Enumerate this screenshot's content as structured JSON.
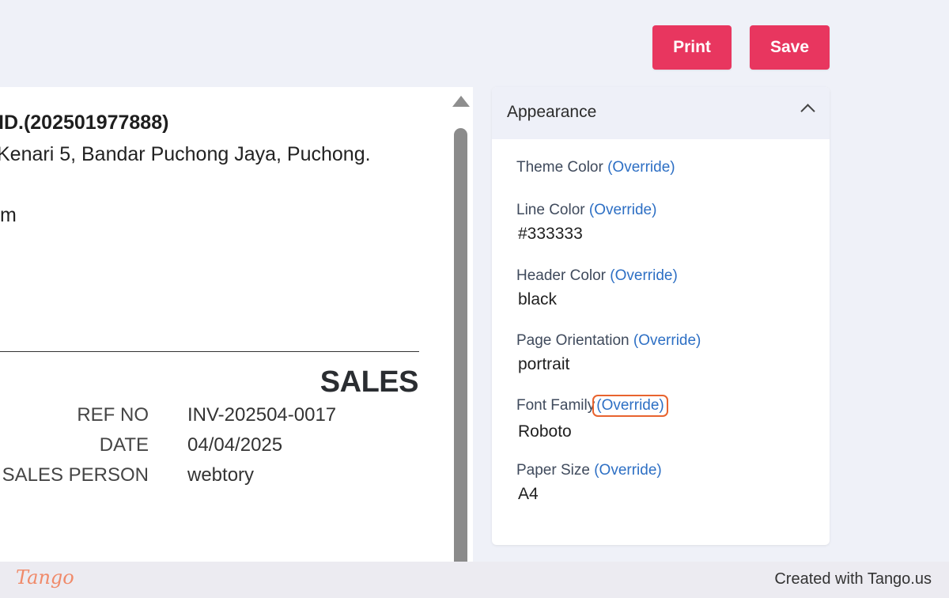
{
  "toolbar": {
    "print_label": "Print",
    "save_label": "Save",
    "button_color": "#e8365f"
  },
  "document": {
    "company_line": "ID.(202501977888)",
    "address_line": "Kenari 5, Bandar Puchong Jaya, Puchong.",
    "email_fragment": "m",
    "doc_title": "SALES",
    "meta": [
      {
        "label": "REF NO",
        "value": "INV-202504-0017"
      },
      {
        "label": "DATE",
        "value": "04/04/2025"
      },
      {
        "label": "SALES PERSON",
        "value": "webtory"
      }
    ]
  },
  "appearance": {
    "title": "Appearance",
    "override_text": "(Override)",
    "fields": [
      {
        "label": "Theme Color",
        "value": ""
      },
      {
        "label": "Line Color",
        "value": "#333333"
      },
      {
        "label": "Header Color",
        "value": "black"
      },
      {
        "label": "Page Orientation",
        "value": "portrait"
      },
      {
        "label": "Font Family",
        "value": "Roboto"
      },
      {
        "label": "Paper Size",
        "value": "A4"
      }
    ],
    "highlighted_field": "Font Family",
    "highlight_color": "#e8632e",
    "link_color": "#2d6fc4"
  },
  "footer": {
    "logo_text": "Tango",
    "credit": "Created with Tango.us"
  }
}
